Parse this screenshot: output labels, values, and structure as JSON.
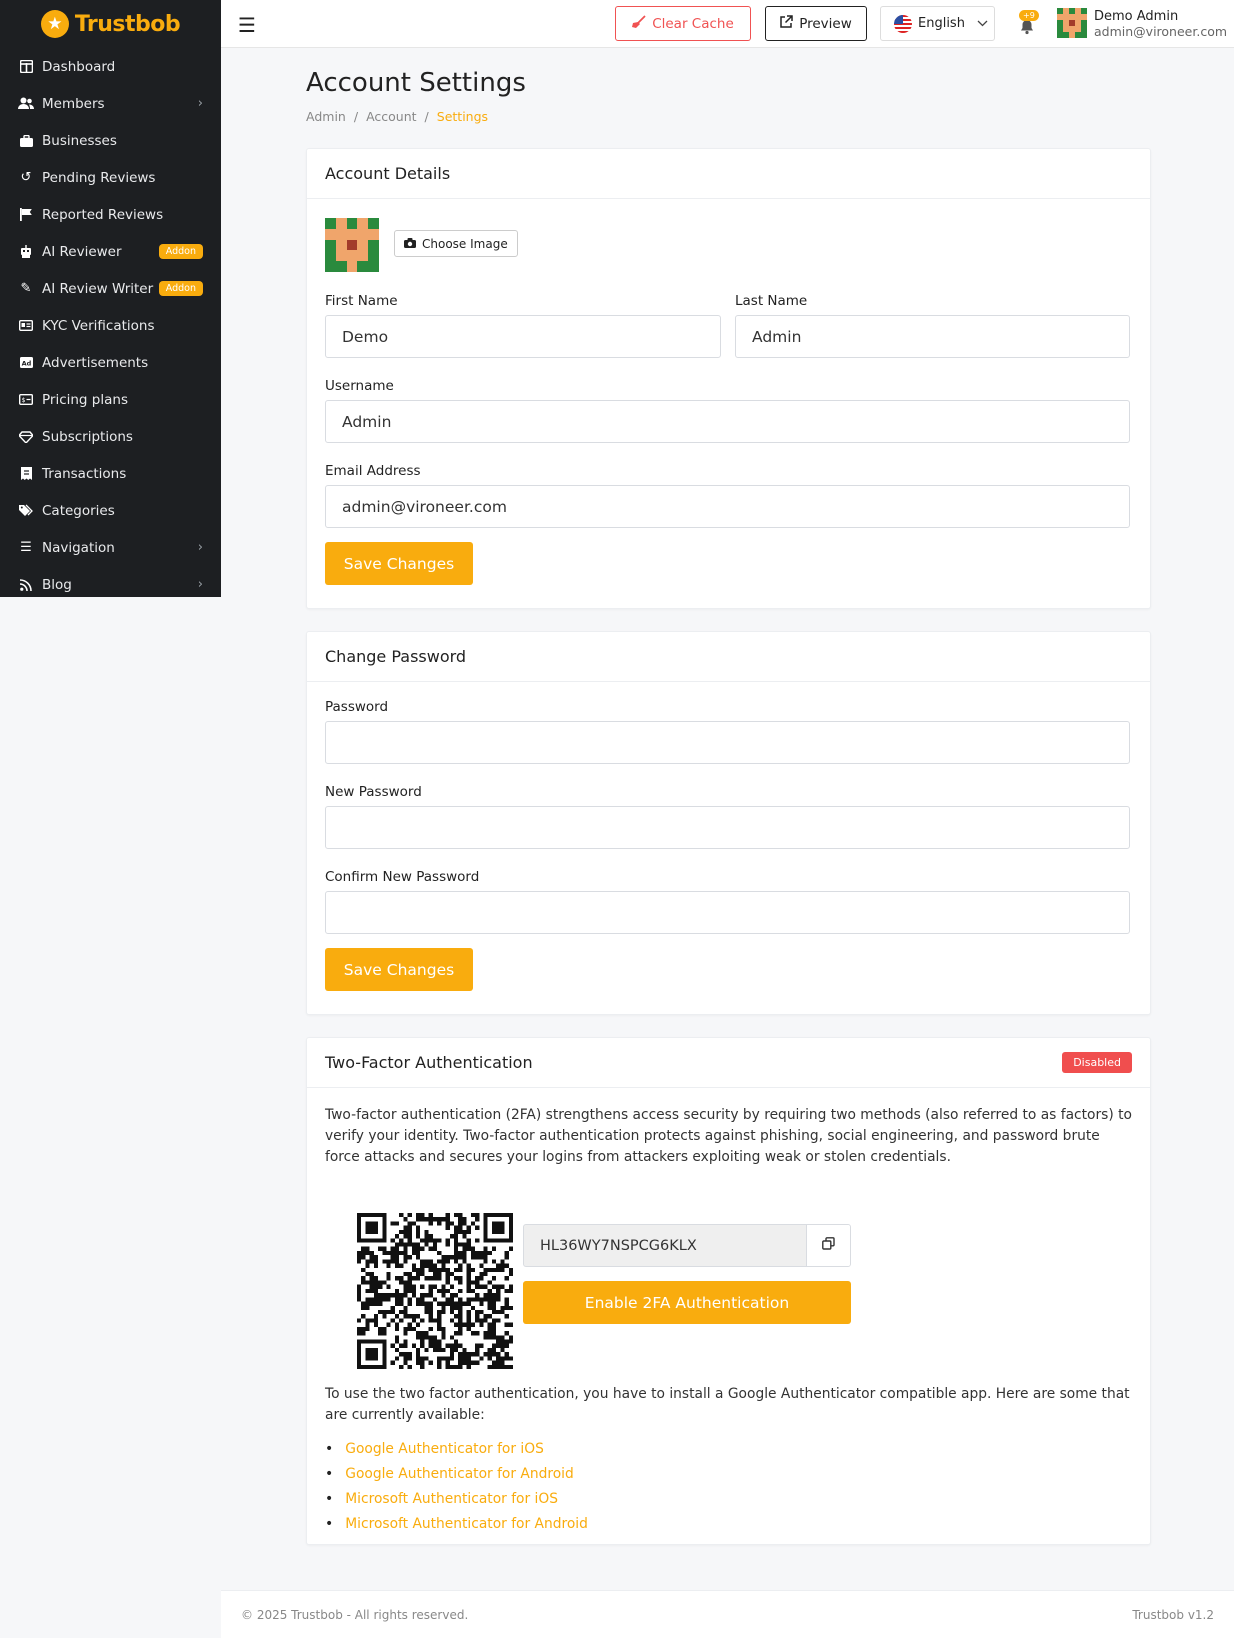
{
  "brand": {
    "name": "Trustbob",
    "accent": "#f9ac0e"
  },
  "sidebar": {
    "items": [
      {
        "label": "Dashboard",
        "icon": "dashboard-icon",
        "chevron": false
      },
      {
        "label": "Members",
        "icon": "users-icon",
        "chevron": true
      },
      {
        "label": "Businesses",
        "icon": "briefcase-icon",
        "chevron": false
      },
      {
        "label": "Pending Reviews",
        "icon": "history-icon",
        "chevron": false
      },
      {
        "label": "Reported Reviews",
        "icon": "flag-icon",
        "chevron": false
      },
      {
        "label": "AI Reviewer",
        "icon": "robot-icon",
        "chevron": false,
        "badge": "Addon"
      },
      {
        "label": "AI Review Writer",
        "icon": "pen-icon",
        "chevron": false,
        "badge": "Addon"
      },
      {
        "label": "KYC Verifications",
        "icon": "id-card-icon",
        "chevron": false
      },
      {
        "label": "Advertisements",
        "icon": "ad-icon",
        "chevron": false
      },
      {
        "label": "Pricing plans",
        "icon": "money-icon",
        "chevron": false
      },
      {
        "label": "Subscriptions",
        "icon": "gem-icon",
        "chevron": false
      },
      {
        "label": "Transactions",
        "icon": "receipt-icon",
        "chevron": false
      },
      {
        "label": "Categories",
        "icon": "tags-icon",
        "chevron": false
      },
      {
        "label": "Navigation",
        "icon": "list-icon",
        "chevron": true
      },
      {
        "label": "Blog",
        "icon": "rss-icon",
        "chevron": true
      }
    ]
  },
  "topbar": {
    "clear_cache": "Clear Cache",
    "preview": "Preview",
    "language": "English",
    "notif_count": "+9",
    "user_name": "Demo Admin",
    "user_email": "admin@vironeer.com"
  },
  "page": {
    "title": "Account Settings",
    "breadcrumb": [
      "Admin",
      "Account",
      "Settings"
    ]
  },
  "account": {
    "heading": "Account Details",
    "choose_image": "Choose Image",
    "first_name_label": "First Name",
    "first_name": "Demo",
    "last_name_label": "Last Name",
    "last_name": "Admin",
    "username_label": "Username",
    "username": "Admin",
    "email_label": "Email Address",
    "email": "admin@vironeer.com",
    "save": "Save Changes"
  },
  "password": {
    "heading": "Change Password",
    "password_label": "Password",
    "new_label": "New Password",
    "confirm_label": "Confirm New Password",
    "save": "Save Changes"
  },
  "twofa": {
    "heading": "Two-Factor Authentication",
    "status": "Disabled",
    "status_color": "#f04e4e",
    "description": "Two-factor authentication (2FA) strengthens access security by requiring two methods (also referred to as factors) to verify your identity. Two-factor authentication protects against phishing, social engineering, and password brute force attacks and secures your logins from attackers exploiting weak or stolen credentials.",
    "secret": "HL36WY7NSPCG6KLX",
    "enable": "Enable 2FA Authentication",
    "apps_intro": "To use the two factor authentication, you have to install a Google Authenticator compatible app. Here are some that are currently available:",
    "apps": [
      "Google Authenticator for iOS",
      "Google Authenticator for Android",
      "Microsoft Authenticator for iOS",
      "Microsoft Authenticator for Android"
    ]
  },
  "footer": {
    "copyright": "© 2025 Trustbob - All rights reserved.",
    "version": "Trustbob v1.2"
  }
}
